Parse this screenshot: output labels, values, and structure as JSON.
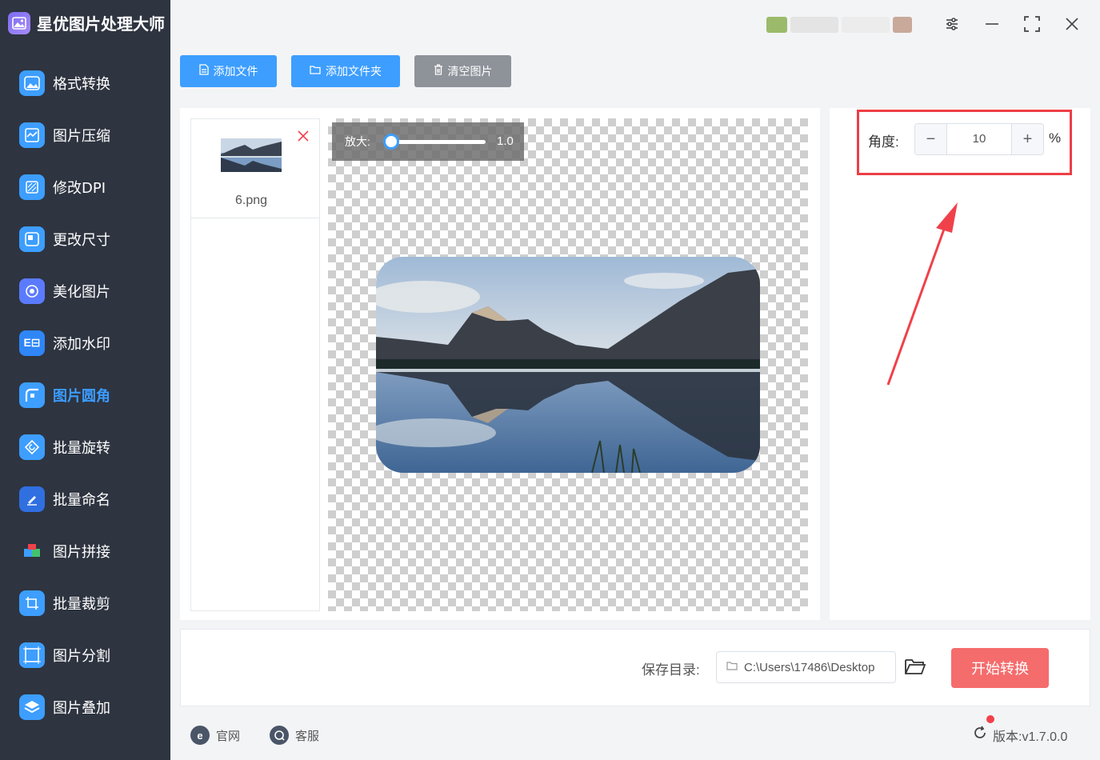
{
  "app": {
    "title": "星优图片处理大师"
  },
  "sidebar": {
    "items": [
      {
        "label": "格式转换",
        "icon": "image-convert-icon",
        "color": "#3d9eff"
      },
      {
        "label": "图片压缩",
        "icon": "compress-icon",
        "color": "#3d9eff"
      },
      {
        "label": "修改DPI",
        "icon": "dpi-icon",
        "color": "#3d9eff"
      },
      {
        "label": "更改尺寸",
        "icon": "resize-icon",
        "color": "#3d9eff"
      },
      {
        "label": "美化图片",
        "icon": "beautify-icon",
        "color": "#5b7bff"
      },
      {
        "label": "添加水印",
        "icon": "watermark-icon",
        "color": "#2f86f7"
      },
      {
        "label": "图片圆角",
        "icon": "rounded-corner-icon",
        "color": "#3d9eff",
        "active": true
      },
      {
        "label": "批量旋转",
        "icon": "rotate-icon",
        "color": "#3d9eff"
      },
      {
        "label": "批量命名",
        "icon": "rename-icon",
        "color": "#2f6fe0"
      },
      {
        "label": "图片拼接",
        "icon": "puzzle-icon",
        "color": "#f5a623"
      },
      {
        "label": "批量裁剪",
        "icon": "crop-icon",
        "color": "#3d9eff"
      },
      {
        "label": "图片分割",
        "icon": "split-icon",
        "color": "#3d9eff"
      },
      {
        "label": "图片叠加",
        "icon": "layers-icon",
        "color": "#3d9eff"
      }
    ]
  },
  "toolbar": {
    "add_file": "添加文件",
    "add_folder": "添加文件夹",
    "clear": "清空图片"
  },
  "files": [
    {
      "name": "6.png"
    }
  ],
  "preview": {
    "zoom_label": "放大:",
    "zoom_value": "1.0",
    "zoom_fraction": 0.0
  },
  "settings": {
    "angle_label": "角度:",
    "angle_value": "10",
    "unit": "%"
  },
  "save": {
    "label": "保存目录:",
    "path": "C:\\Users\\17486\\Desktop"
  },
  "actions": {
    "start": "开始转换"
  },
  "footer": {
    "website": "官网",
    "support": "客服",
    "version": "版本:v1.7.0.0"
  },
  "colors": {
    "accent": "#3d9eff",
    "start": "#f56c6c",
    "highlight": "#ee3d45",
    "sidebar": "#2e3440"
  }
}
